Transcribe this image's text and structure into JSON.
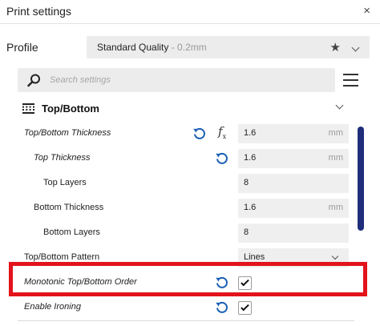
{
  "window": {
    "title": "Print settings",
    "close_glyph": "×"
  },
  "profile": {
    "label": "Profile",
    "value": "Standard Quality",
    "detail": " - 0.2mm",
    "favorite_icon": "star-icon",
    "dropdown_icon": "chevron-down-icon"
  },
  "search": {
    "placeholder": "Search settings",
    "value": ""
  },
  "menu_icon": "hamburger-menu-icon",
  "section": {
    "title": "Top/Bottom",
    "icon": "top-bottom-layers-icon"
  },
  "settings": [
    {
      "label": "Top/Bottom Thickness",
      "italic": true,
      "reset": true,
      "fx": true,
      "type": "number",
      "value": "1.6",
      "unit": "mm"
    },
    {
      "label": "Top Thickness",
      "italic": true,
      "reset": true,
      "fx": false,
      "type": "number",
      "value": "1.6",
      "unit": "mm"
    },
    {
      "label": "Top Layers",
      "italic": false,
      "reset": false,
      "fx": false,
      "type": "number",
      "value": "8",
      "unit": ""
    },
    {
      "label": "Bottom Thickness",
      "italic": false,
      "reset": false,
      "fx": false,
      "type": "number",
      "value": "1.6",
      "unit": "mm"
    },
    {
      "label": "Bottom Layers",
      "italic": false,
      "reset": false,
      "fx": false,
      "type": "number",
      "value": "8",
      "unit": ""
    },
    {
      "label": "Top/Bottom Pattern",
      "italic": false,
      "reset": false,
      "fx": false,
      "type": "select",
      "value": "Lines",
      "unit": ""
    },
    {
      "label": "Monotonic Top/Bottom Order",
      "italic": true,
      "reset": true,
      "fx": false,
      "type": "checkbox",
      "checked": true
    },
    {
      "label": "Enable Ironing",
      "italic": true,
      "reset": true,
      "fx": false,
      "type": "checkbox",
      "checked": true
    }
  ],
  "fx_glyph": "f",
  "fx_sub": "x",
  "colors": {
    "accent": "#1f2d7a",
    "reset_icon": "#1a5fb4",
    "highlight": "#e3131b",
    "field_bg": "#efefef"
  }
}
